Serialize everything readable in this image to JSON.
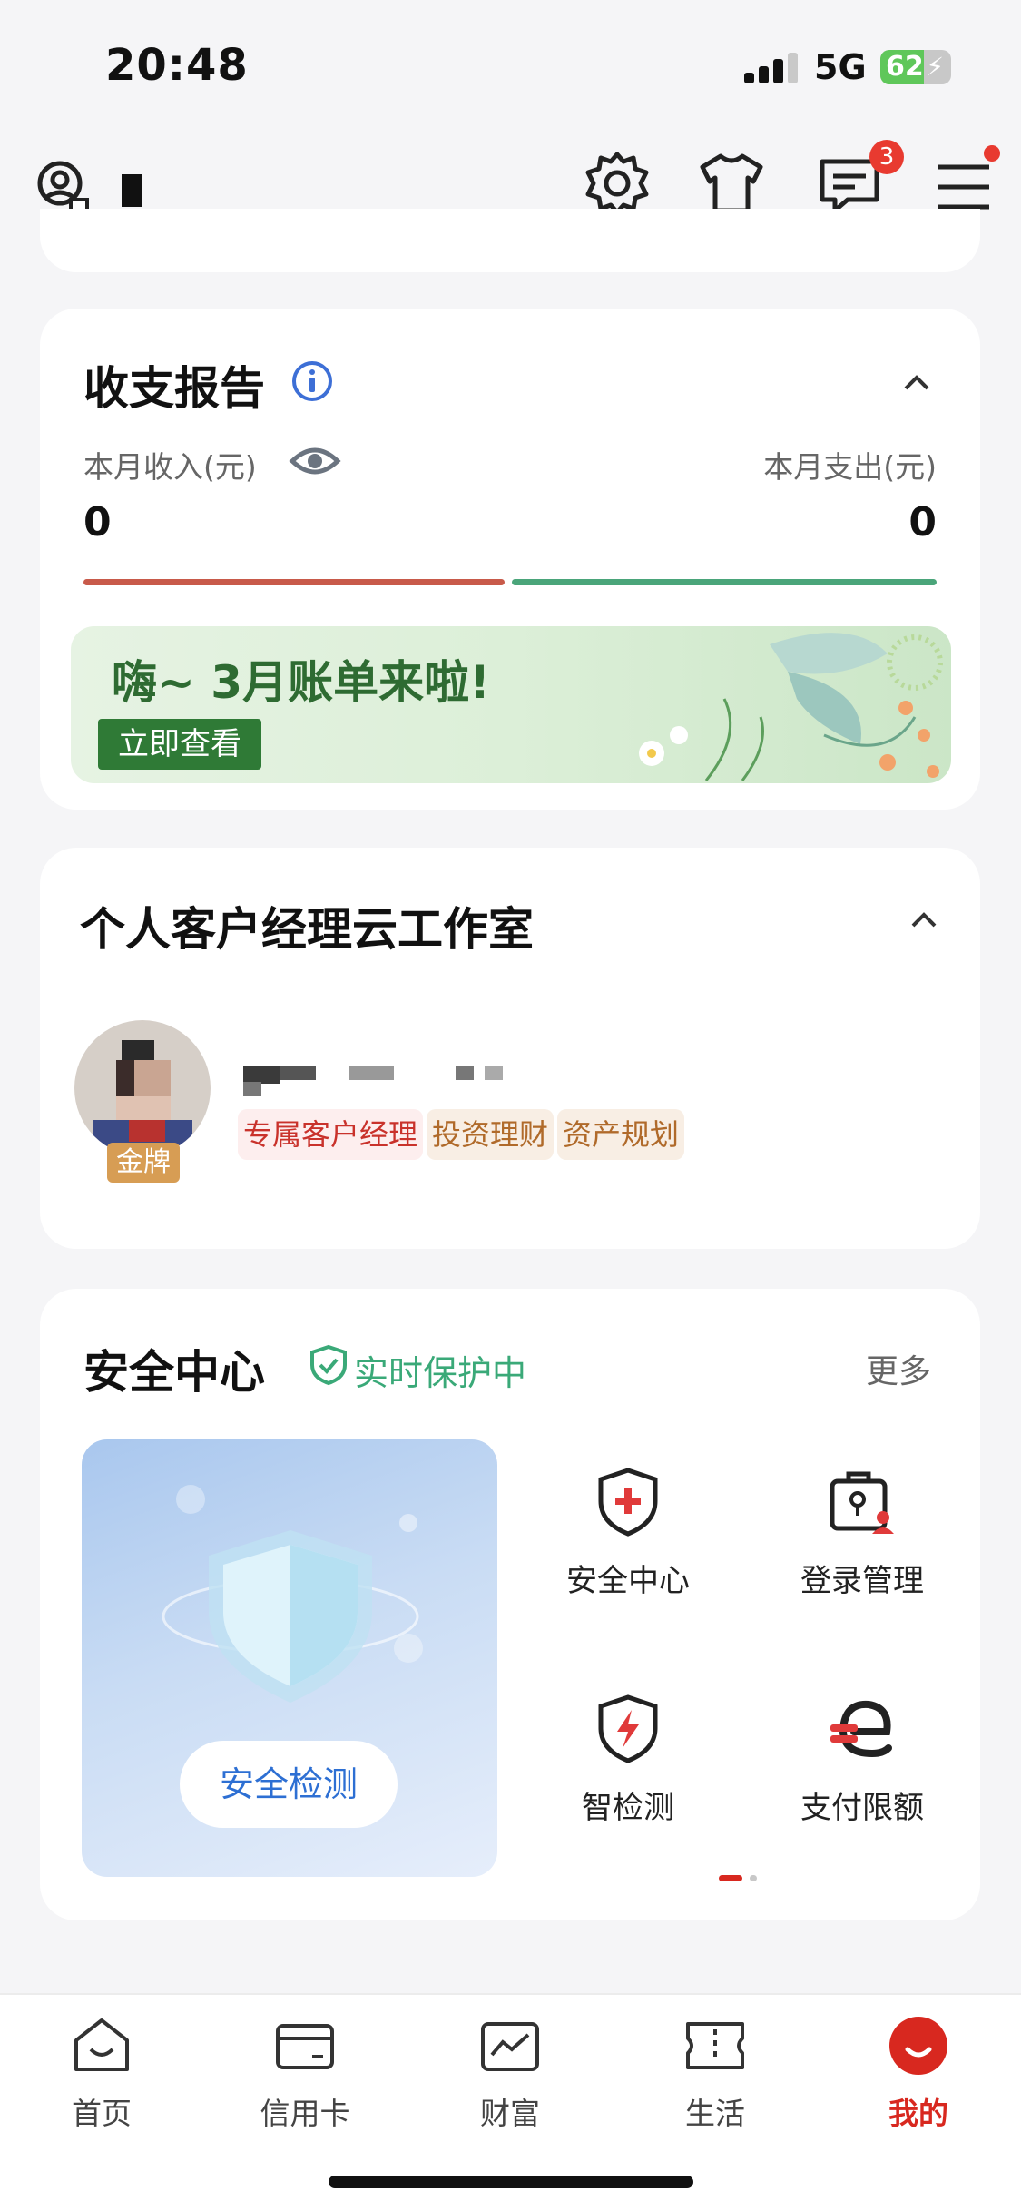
{
  "status": {
    "time": "20:48",
    "network": "5G",
    "battery": "62",
    "battery_level": 0.62
  },
  "header": {
    "message_badge": "3"
  },
  "report": {
    "title": "收支报告",
    "income_label": "本月收入(元)",
    "expense_label": "本月支出(元)",
    "income_value": "0",
    "expense_value": "0",
    "banner_title": "嗨~ 3月账单来啦!",
    "banner_button": "立即查看",
    "colors": {
      "income": "#c85a4a",
      "expense": "#4aa57a"
    }
  },
  "manager": {
    "title": "个人客户经理云工作室",
    "badge": "金牌",
    "tags": [
      "专属客户经理",
      "投资理财",
      "资产规划"
    ]
  },
  "security": {
    "title": "安全中心",
    "status": "实时保护中",
    "more": "更多",
    "check_button": "安全检测",
    "items": [
      {
        "label": "安全中心",
        "icon": "shield-plus-icon"
      },
      {
        "label": "登录管理",
        "icon": "lock-user-icon"
      },
      {
        "label": "智检测",
        "icon": "shield-bolt-icon"
      },
      {
        "label": "支付限额",
        "icon": "payment-limit-icon"
      }
    ]
  },
  "tabbar": {
    "tabs": [
      {
        "label": "首页",
        "icon": "home-icon"
      },
      {
        "label": "信用卡",
        "icon": "credit-card-icon"
      },
      {
        "label": "财富",
        "icon": "wealth-chart-icon"
      },
      {
        "label": "生活",
        "icon": "ticket-icon"
      },
      {
        "label": "我的",
        "icon": "profile-icon"
      }
    ],
    "active": "我的",
    "active_color": "#d8281f"
  }
}
